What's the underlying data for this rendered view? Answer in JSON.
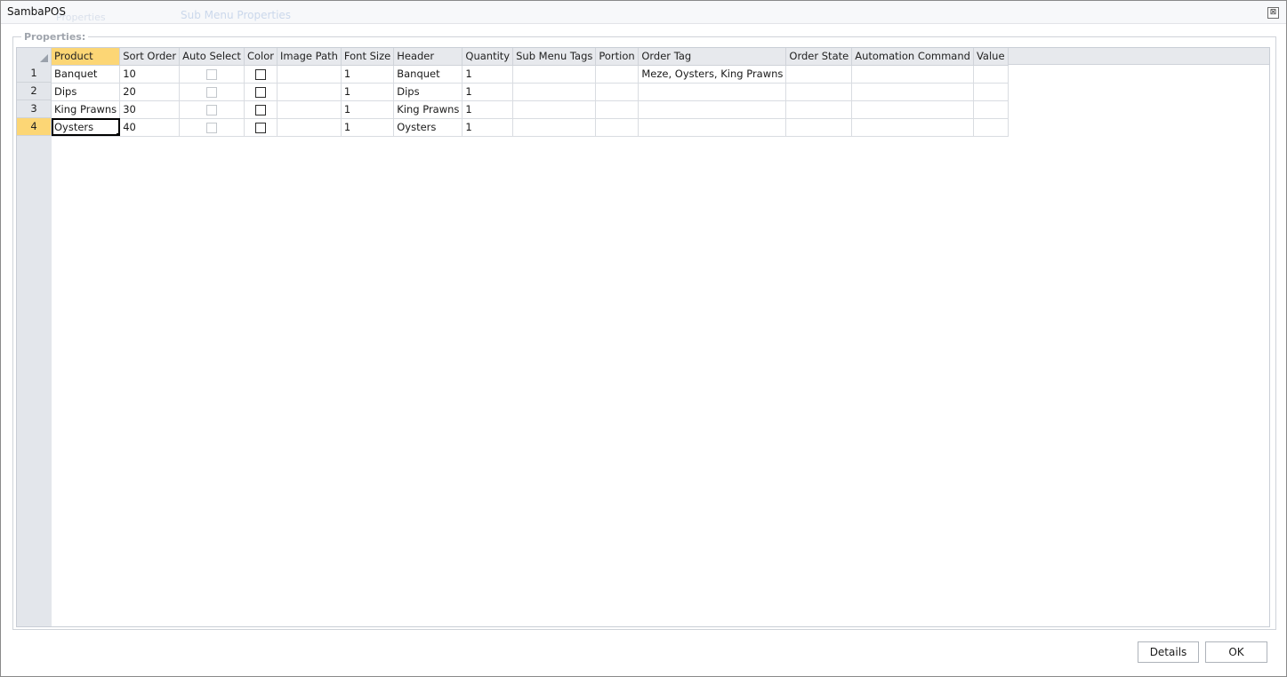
{
  "window": {
    "title": "SambaPOS",
    "background_title": "Sub Menu Properties",
    "background_hint": "Properties",
    "close_glyph": "⊠"
  },
  "properties": {
    "label": "Properties:",
    "columns": [
      "Product",
      "Sort Order",
      "Auto Select",
      "Color",
      "Image Path",
      "Font Size",
      "Header",
      "Quantity",
      "Sub Menu Tags",
      "Portion",
      "Order Tag",
      "Order State",
      "Automation Command",
      "Value"
    ],
    "active_column": "Product",
    "active_row": 4,
    "rows": [
      {
        "num": "1",
        "product": "Banquet",
        "sort_order": "10",
        "auto_select": false,
        "color": "",
        "image_path": "",
        "font_size": "1",
        "header": "Banquet",
        "quantity": "1",
        "sub_menu_tags": "",
        "portion": "",
        "order_tag": "Meze, Oysters, King Prawns",
        "order_state": "",
        "automation_command": "",
        "value": ""
      },
      {
        "num": "2",
        "product": "Dips",
        "sort_order": "20",
        "auto_select": false,
        "color": "",
        "image_path": "",
        "font_size": "1",
        "header": "Dips",
        "quantity": "1",
        "sub_menu_tags": "",
        "portion": "",
        "order_tag": "",
        "order_state": "",
        "automation_command": "",
        "value": ""
      },
      {
        "num": "3",
        "product": "King Prawns",
        "sort_order": "30",
        "auto_select": false,
        "color": "",
        "image_path": "",
        "font_size": "1",
        "header": "King Prawns",
        "quantity": "1",
        "sub_menu_tags": "",
        "portion": "",
        "order_tag": "",
        "order_state": "",
        "automation_command": "",
        "value": ""
      },
      {
        "num": "4",
        "product": "Oysters",
        "sort_order": "40",
        "auto_select": false,
        "color": "",
        "image_path": "",
        "font_size": "1",
        "header": "Oysters",
        "quantity": "1",
        "sub_menu_tags": "",
        "portion": "",
        "order_tag": "",
        "order_state": "",
        "automation_command": "",
        "value": ""
      }
    ]
  },
  "buttons": {
    "details": "Details",
    "ok": "OK"
  },
  "colors": {
    "selection": "#fcd675",
    "header_bg": "#e7e9ed",
    "grid_line": "#d9dce1"
  }
}
